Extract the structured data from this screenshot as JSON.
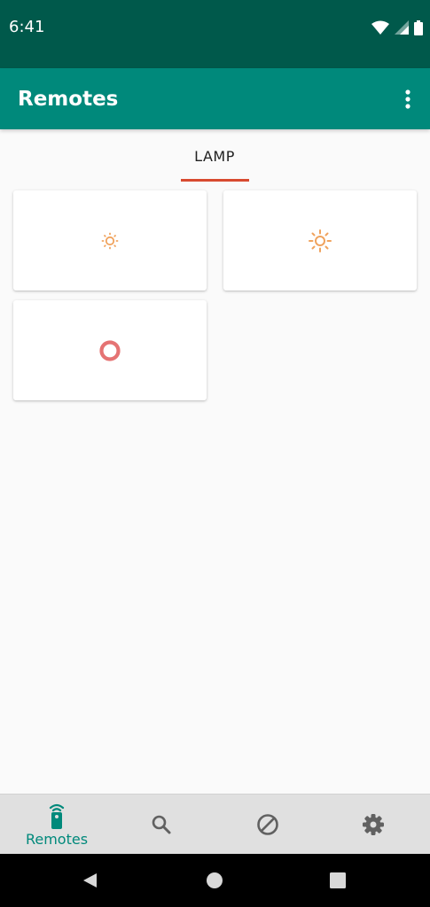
{
  "status_bar": {
    "time": "6:41",
    "icons": [
      "wifi-icon",
      "signal-icon",
      "battery-icon"
    ]
  },
  "app_bar": {
    "title": "Remotes",
    "overflow_icon": "more-vert-icon"
  },
  "tabs": [
    {
      "label": "LAMP",
      "selected": true
    }
  ],
  "cards": [
    {
      "icon": "brightness-low-icon"
    },
    {
      "icon": "brightness-high-icon"
    },
    {
      "icon": "power-ring-icon"
    }
  ],
  "bottom_nav": {
    "items": [
      {
        "label": "Remotes",
        "icon": "remote-icon",
        "selected": true
      },
      {
        "label": "",
        "icon": "search-icon",
        "selected": false
      },
      {
        "label": "",
        "icon": "block-icon",
        "selected": false
      },
      {
        "label": "",
        "icon": "gear-icon",
        "selected": false
      }
    ]
  },
  "system_nav": [
    "back-icon",
    "home-icon",
    "recents-icon"
  ],
  "colors": {
    "status_bar": "#00594b",
    "app_bar": "#00897b",
    "accent": "#00897b",
    "tab_indicator": "#d84a30",
    "sun_icon": "#f0a35e",
    "power_ring": "#e57373"
  }
}
